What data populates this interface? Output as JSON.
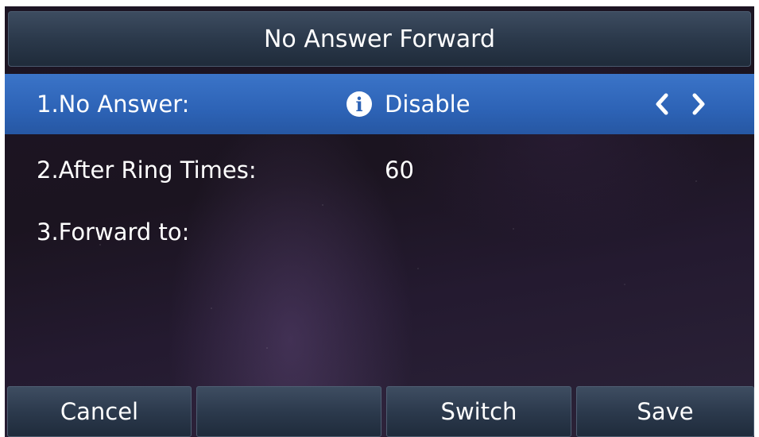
{
  "header": {
    "title": "No Answer Forward"
  },
  "rows": [
    {
      "label": "1.No Answer:",
      "value": "Disable",
      "selected": true
    },
    {
      "label": "2.After Ring Times:",
      "value": "60"
    },
    {
      "label": "3.Forward to:",
      "value": ""
    }
  ],
  "softkeys": [
    "Cancel",
    "",
    "Switch",
    "Save"
  ],
  "colors": {
    "title_bar": "#2b394b",
    "selected_row": "#2d63b6",
    "text": "#ffffff",
    "background": "#1d1524"
  },
  "icons": {
    "info": "info-icon",
    "left": "chevron-left-icon",
    "right": "chevron-right-icon"
  }
}
